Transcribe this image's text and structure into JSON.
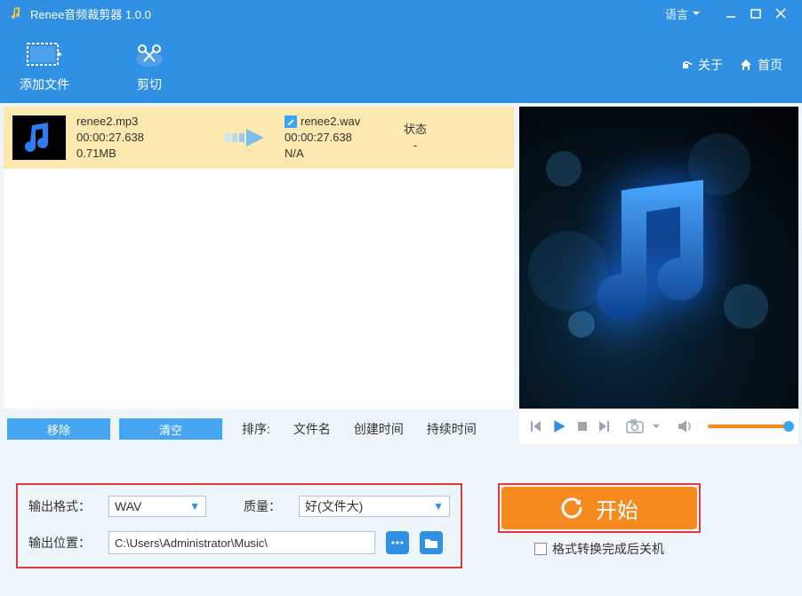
{
  "titlebar": {
    "title": "Renee音频裁剪器 1.0.0",
    "language": "语言"
  },
  "toolbar": {
    "add_label": "添加文件",
    "cut_label": "剪切",
    "about_label": "关于",
    "home_label": "首页"
  },
  "list": {
    "item": {
      "src_name": "renee2.mp3",
      "src_duration": "00:00:27.638",
      "src_size": "0.71MB",
      "out_name": "renee2.wav",
      "out_duration": "00:00:27.638",
      "out_size": "N/A",
      "status_header": "状态",
      "status_value": "-"
    },
    "buttons": {
      "remove": "移除",
      "clear": "清空"
    },
    "sort": {
      "label": "排序:",
      "by_name": "文件名",
      "by_created": "创建时间",
      "by_duration": "持续时间"
    }
  },
  "output": {
    "format_label": "输出格式：",
    "format_value": "WAV",
    "quality_label": "质量：",
    "quality_value": "好(文件大)",
    "path_label": "输出位置：",
    "path_value": "C:\\Users\\Administrator\\Music\\"
  },
  "start": {
    "label": "开始",
    "shutdown_label": "格式转换完成后关机"
  }
}
